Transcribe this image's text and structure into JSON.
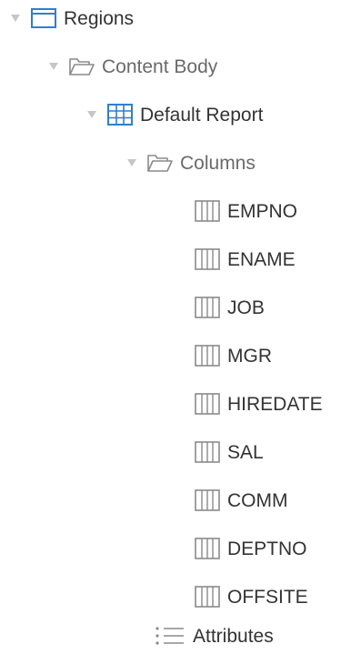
{
  "tree": {
    "regions": {
      "label": "Regions",
      "icon": "region-icon"
    },
    "content_body": {
      "label": "Content Body",
      "icon": "folder-icon"
    },
    "default_report": {
      "label": "Default Report",
      "icon": "table-icon"
    },
    "columns_folder": {
      "label": "Columns",
      "icon": "folder-icon"
    },
    "columns": [
      {
        "label": "EMPNO",
        "icon": "column-icon"
      },
      {
        "label": "ENAME",
        "icon": "column-icon"
      },
      {
        "label": "JOB",
        "icon": "column-icon"
      },
      {
        "label": "MGR",
        "icon": "column-icon"
      },
      {
        "label": "HIREDATE",
        "icon": "column-icon"
      },
      {
        "label": "SAL",
        "icon": "column-icon"
      },
      {
        "label": "COMM",
        "icon": "column-icon"
      },
      {
        "label": "DEPTNO",
        "icon": "column-icon"
      },
      {
        "label": "OFFSITE",
        "icon": "column-icon"
      }
    ],
    "attributes": {
      "label": "Attributes",
      "icon": "list-icon"
    }
  },
  "colors": {
    "accent_blue": "#2f7fcf",
    "icon_gray": "#8a8a8a",
    "text": "#333333"
  }
}
